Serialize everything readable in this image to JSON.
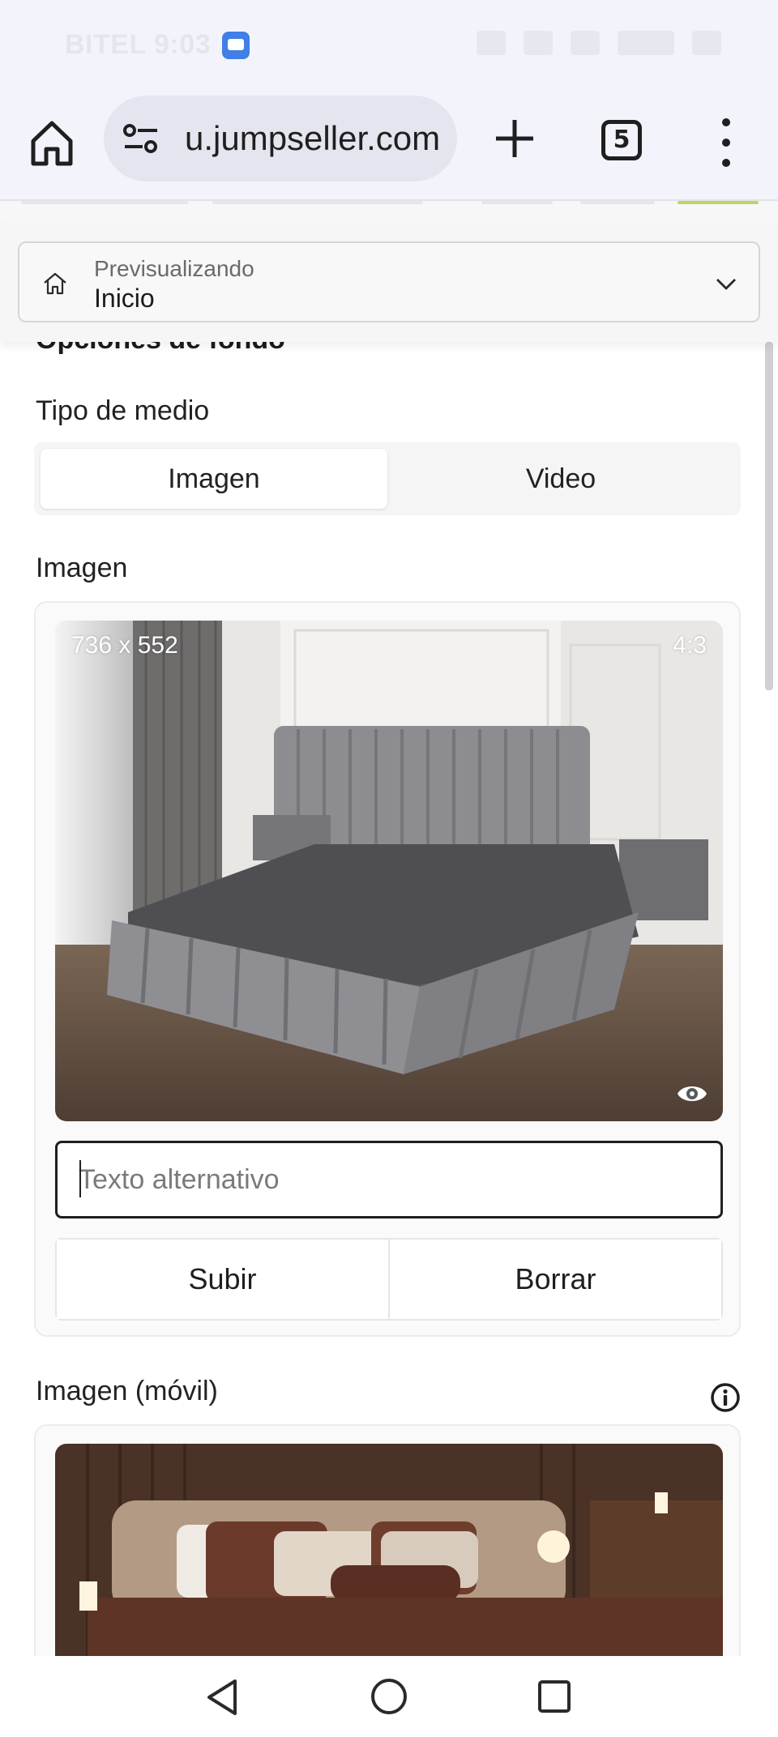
{
  "status_bar": {
    "time_text": "BITEL 9:03"
  },
  "browser": {
    "url": "u.jumpseller.com",
    "tab_count": "5"
  },
  "preview": {
    "label": "Previsualizando",
    "value": "Inicio"
  },
  "section": {
    "title": "Opciones de fondo",
    "media_type_label": "Tipo de medio",
    "media_options": [
      "Imagen",
      "Video"
    ],
    "selected_media": "Imagen"
  },
  "image_field": {
    "label": "Imagen",
    "dimensions": "736 x 552",
    "aspect_ratio": "4:3",
    "alt_placeholder": "Texto alternativo",
    "upload_label": "Subir",
    "delete_label": "Borrar"
  },
  "mobile_image_field": {
    "label": "Imagen (móvil)"
  },
  "icons": {
    "home": "home-icon",
    "site_settings": "tune-icon",
    "new_tab": "plus-icon",
    "tabs": "tabs-icon",
    "menu": "more-vert-icon",
    "preview": "home-outline-icon",
    "dropdown": "chevron-down-icon",
    "preview_image": "eye-icon",
    "info": "info-icon",
    "nav_back": "back-triangle-icon",
    "nav_home": "home-circle-icon",
    "nav_recent": "recent-square-icon"
  }
}
